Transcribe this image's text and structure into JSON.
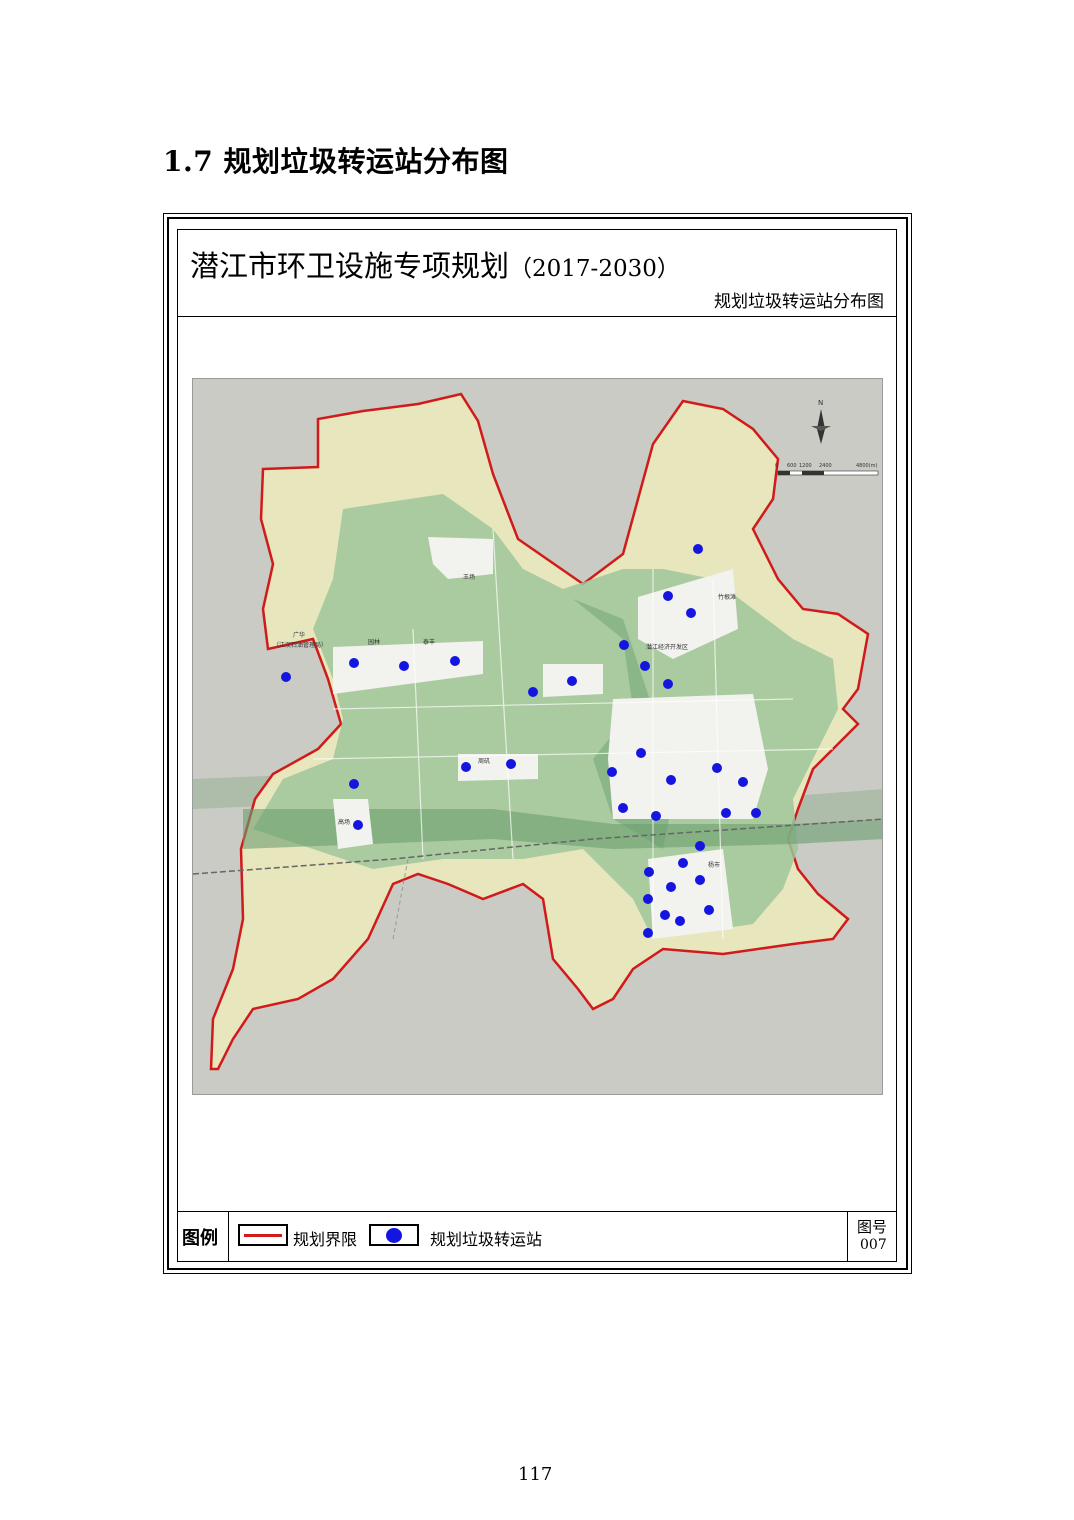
{
  "heading": "1.7 规划垃圾转运站分布图",
  "plan": {
    "title": "潜江市环卫设施专项规划",
    "years": "（2017-2030）",
    "subtitle": "规划垃圾转运站分布图"
  },
  "legend": {
    "label": "图例",
    "boundary": "规划界限",
    "station": "规划垃圾转运站"
  },
  "figure": {
    "label": "图号",
    "number": "007"
  },
  "map": {
    "north_symbol": "N",
    "scale_ticks": [
      "0",
      "600",
      "1200",
      "2400",
      "4800(m)"
    ],
    "place_labels": [
      "王场",
      "竹根滩",
      "潜江经济开发区",
      "广华",
      "（江汉石油管理局）",
      "周矶",
      "杨市",
      "高场",
      "园林",
      "泰丰"
    ],
    "colors": {
      "boundary": "#d11a1a",
      "station": "#1515e0",
      "outside": "#c9cbc4",
      "in_boundary": "#e7e6bd",
      "green": "#9ec59a",
      "urban": "#f2f2ee"
    }
  },
  "page_number": "117"
}
